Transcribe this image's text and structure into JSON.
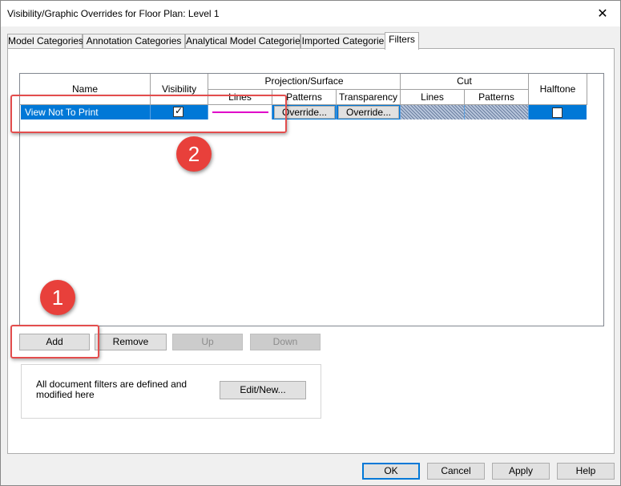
{
  "window": {
    "title": "Visibility/Graphic Overrides for Floor Plan: Level 1"
  },
  "tabs": [
    {
      "label": "Model Categories",
      "active": false
    },
    {
      "label": "Annotation Categories",
      "active": false
    },
    {
      "label": "Analytical Model Categories",
      "active": false
    },
    {
      "label": "Imported Categories",
      "active": false
    },
    {
      "label": "Filters",
      "active": true
    }
  ],
  "grid": {
    "headers": {
      "name": "Name",
      "visibility": "Visibility",
      "projection_surface": "Projection/Surface",
      "proj_lines": "Lines",
      "proj_patterns": "Patterns",
      "proj_transparency": "Transparency",
      "cut": "Cut",
      "cut_lines": "Lines",
      "cut_patterns": "Patterns",
      "halftone": "Halftone"
    },
    "rows": [
      {
        "name": "View Not To Print",
        "visibility_checked": true,
        "line_color": "#e000c8",
        "patterns_label": "Override...",
        "transparency_label": "Override...",
        "halftone_checked": false
      }
    ]
  },
  "list_buttons": {
    "add": "Add",
    "remove": "Remove",
    "up": "Up",
    "down": "Down"
  },
  "filters_box": {
    "note": "All document filters are defined and modified here",
    "edit_new": "Edit/New..."
  },
  "footer": {
    "ok": "OK",
    "cancel": "Cancel",
    "apply": "Apply",
    "help": "Help"
  },
  "annotations": {
    "callout_1": "1",
    "callout_2": "2",
    "callout_color": "#e34d4d"
  },
  "icons": {
    "close": "close-icon",
    "checkmark": "checkmark-icon"
  }
}
